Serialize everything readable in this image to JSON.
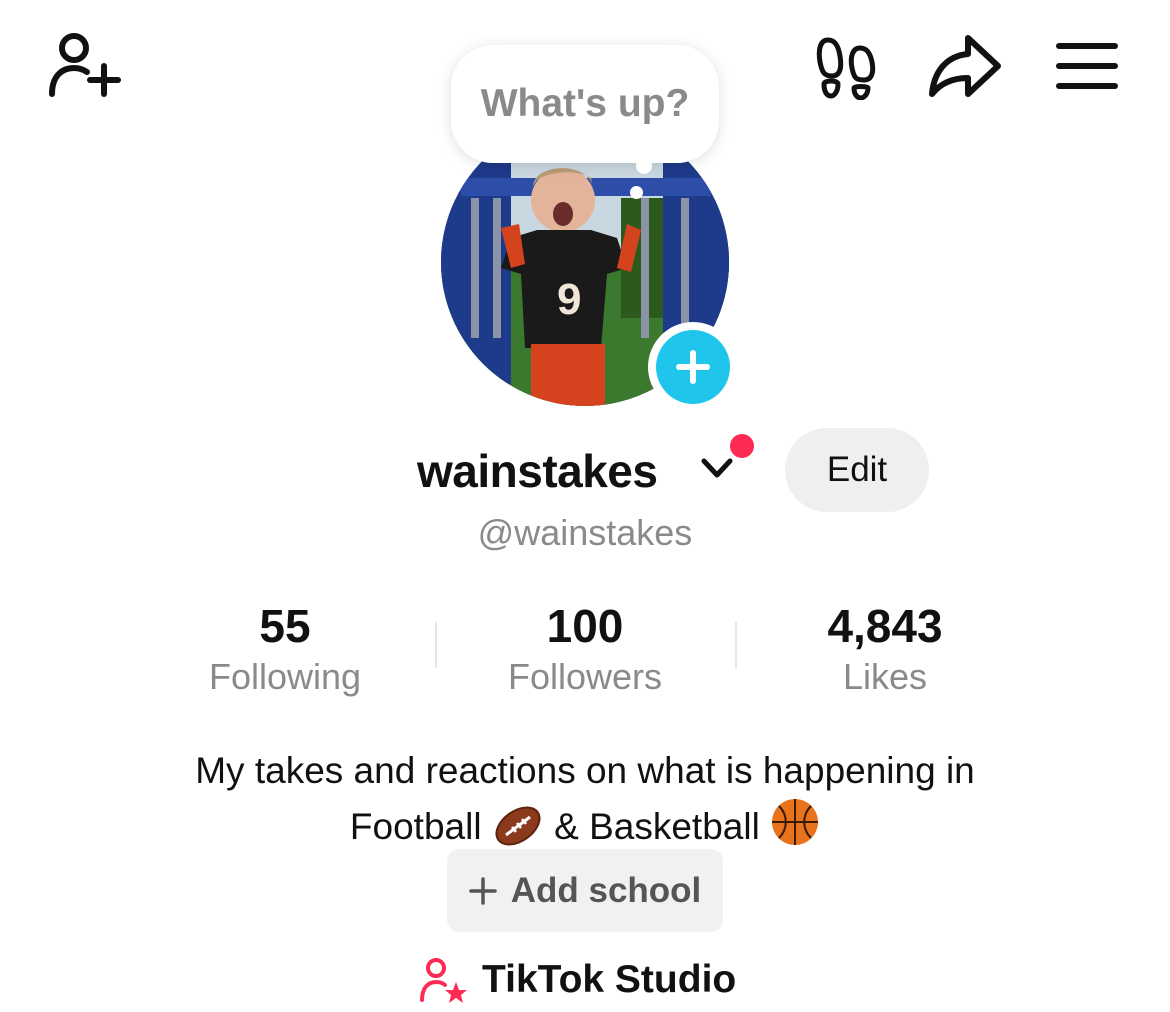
{
  "header": {
    "icons": [
      "add-user-icon",
      "footprints-icon",
      "share-icon",
      "menu-icon"
    ]
  },
  "status_bubble": {
    "text": "What's up?"
  },
  "profile": {
    "username": "wainstakes",
    "handle": "@wainstakes",
    "edit_label": "Edit",
    "notification_color": "#fe2c55",
    "avatar_add_color": "#20c5ec"
  },
  "stats": [
    {
      "value": "55",
      "label": "Following"
    },
    {
      "value": "100",
      "label": "Followers"
    },
    {
      "value": "4,843",
      "label": "Likes"
    }
  ],
  "bio": {
    "line1": "My takes and reactions on what is happening in",
    "line2_a": "Football",
    "line2_b": "& Basketball",
    "emojis": [
      "american-football-emoji",
      "basketball-emoji"
    ]
  },
  "add_school": {
    "label": "Add school"
  },
  "studio": {
    "label": "TikTok Studio",
    "icon_color": "#fe2c55"
  }
}
